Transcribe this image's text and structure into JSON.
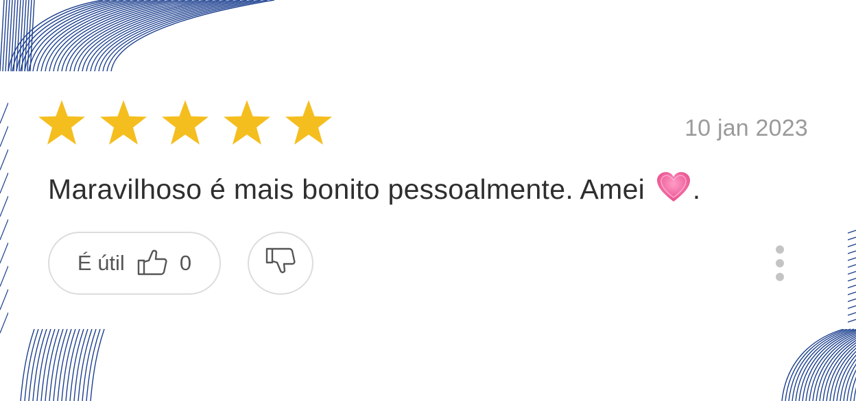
{
  "review": {
    "rating": 5,
    "rating_max": 5,
    "date": "10 jan 2023",
    "text_main": "Maravilhoso é mais bonito pessoalmente. Amei",
    "text_end": ".",
    "emoji_icon": "pink-heart-icon"
  },
  "actions": {
    "useful_label": "É útil",
    "useful_count": "0",
    "like_icon": "thumbs-up-icon",
    "dislike_icon": "thumbs-down-icon",
    "more_icon": "more-vertical-icon"
  },
  "colors": {
    "star": "#F5BE1F",
    "decor_lines": "#1B3F8F",
    "text": "#2E2E2E",
    "muted": "#9A9A9A",
    "heart": "#F0609A"
  }
}
